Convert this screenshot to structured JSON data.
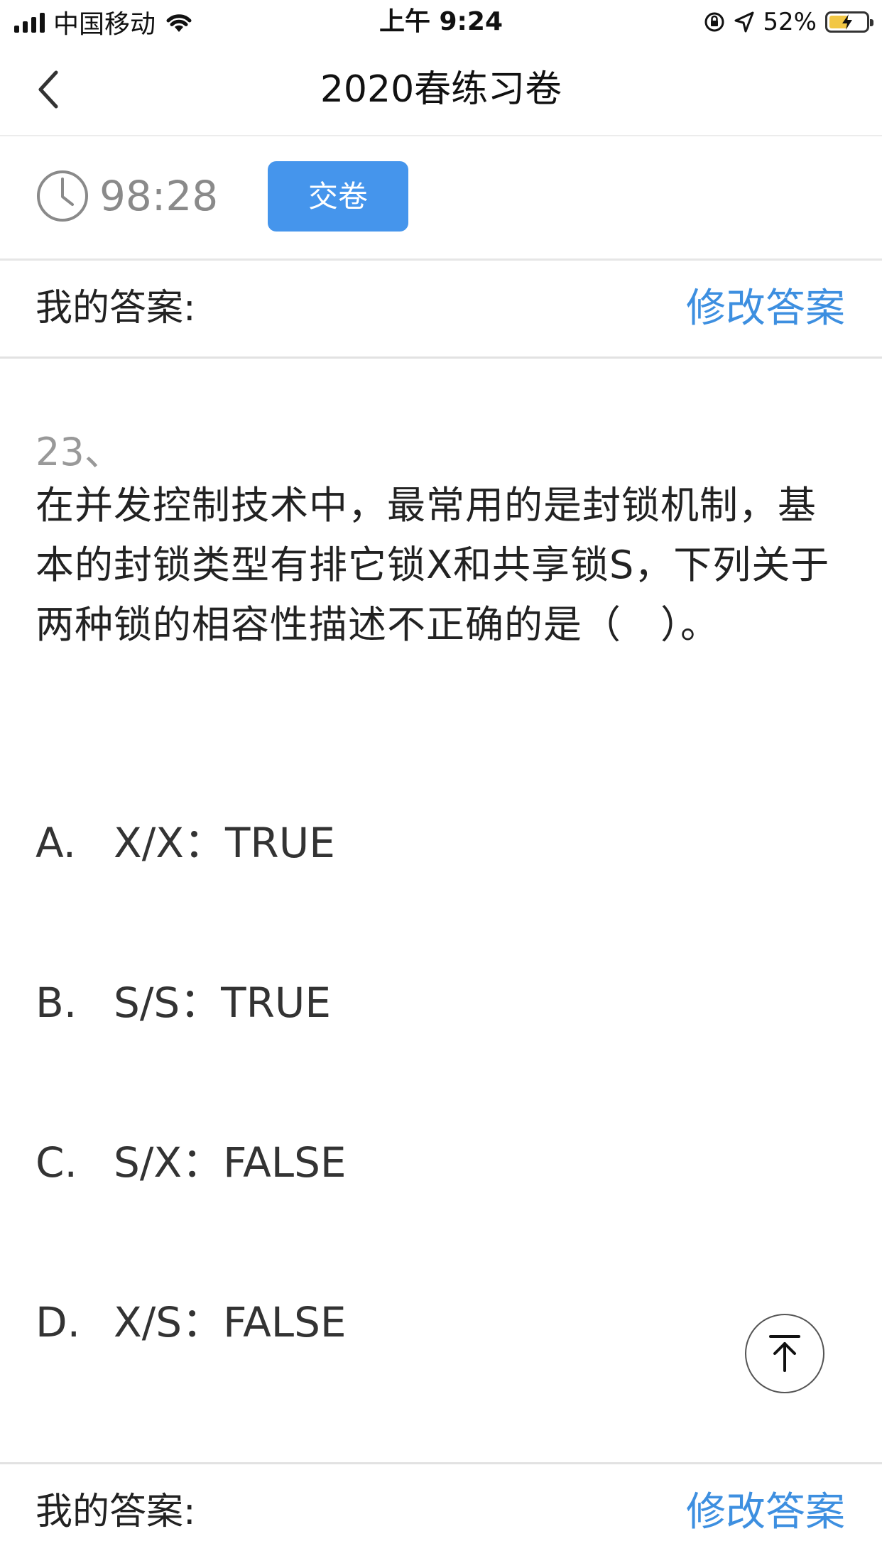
{
  "status_bar": {
    "carrier": "中国移动",
    "time": "上午 9:24",
    "battery_percent": "52%",
    "battery_level": 0.52
  },
  "nav": {
    "title": "2020春练习卷"
  },
  "timer": {
    "time_left": "98:28",
    "submit_label": "交卷"
  },
  "answer_bar": {
    "label": "我的答案:",
    "edit_label": "修改答案"
  },
  "question": {
    "number": "23、",
    "text": "在并发控制技术中，最常用的是封锁机制，基本的封锁类型有排它锁X和共享锁S，下列关于两种锁的相容性描述不正确的是（　）。",
    "options": [
      {
        "letter": "A.",
        "text": "X/X：TRUE"
      },
      {
        "letter": "B.",
        "text": "S/S：TRUE"
      },
      {
        "letter": "C.",
        "text": "S/X：FALSE"
      },
      {
        "letter": "D.",
        "text": "X/S：FALSE"
      }
    ]
  },
  "icons": {
    "back": "chevron-left-icon",
    "clock": "clock-icon",
    "scroll_top": "arrow-up-to-top-icon"
  },
  "colors": {
    "accent": "#4595ec",
    "link": "#3d8fe0",
    "timer_text": "#8a8a8a"
  }
}
